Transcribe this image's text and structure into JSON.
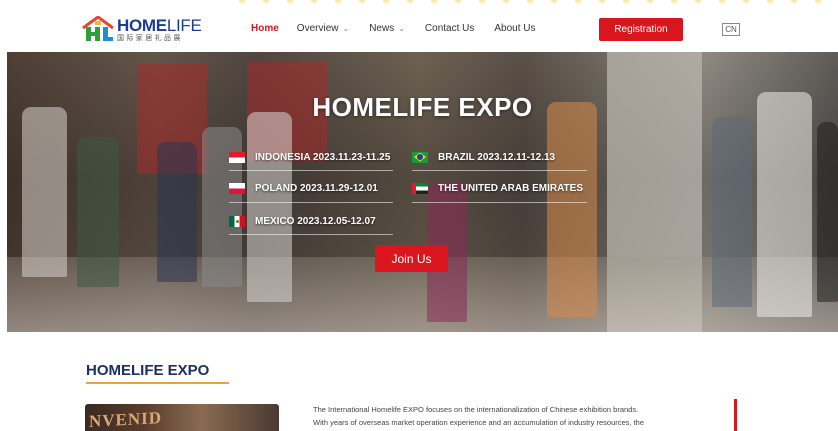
{
  "header": {
    "logo": {
      "brand_bold": "HOME",
      "brand_thin": "LIFE",
      "tagline": "国际家居礼品展"
    },
    "nav": [
      {
        "label": "Home",
        "active": true,
        "has_dropdown": false
      },
      {
        "label": "Overview",
        "active": false,
        "has_dropdown": true
      },
      {
        "label": "News",
        "active": false,
        "has_dropdown": true
      },
      {
        "label": "Contact Us",
        "active": false,
        "has_dropdown": false
      },
      {
        "label": "About Us",
        "active": false,
        "has_dropdown": false
      }
    ],
    "dropdown_icon": "chevron-down-icon",
    "registration_label": "Registration",
    "language_label": "CN"
  },
  "hero": {
    "title": "HOMELIFE EXPO",
    "countries": [
      {
        "flag": "indonesia-flag-icon",
        "label": "INDONESIA 2023.11.23-11.25"
      },
      {
        "flag": "brazil-flag-icon",
        "label": "BRAZIL 2023.12.11-12.13"
      },
      {
        "flag": "poland-flag-icon",
        "label": "POLAND 2023.11.29-12.01"
      },
      {
        "flag": "uae-flag-icon",
        "label": "THE UNITED ARAB EMIRATES"
      },
      {
        "flag": "mexico-flag-icon",
        "label": "MEXICO 2023.12.05-12.07"
      }
    ],
    "join_label": "Join Us"
  },
  "about": {
    "title": "HOMELIFE EXPO",
    "image_text": "NVENID",
    "lines": [
      "The International Homelife EXPO focuses on the internationalization of Chinese exhibition brands.",
      "With years of overseas market operation experience and an accumulation of industry resources, the"
    ]
  },
  "colors": {
    "accent_red": "#d9161e",
    "brand_blue": "#1a3d8f",
    "section_title": "#1a3060",
    "underline_orange": "#e8a33d"
  }
}
